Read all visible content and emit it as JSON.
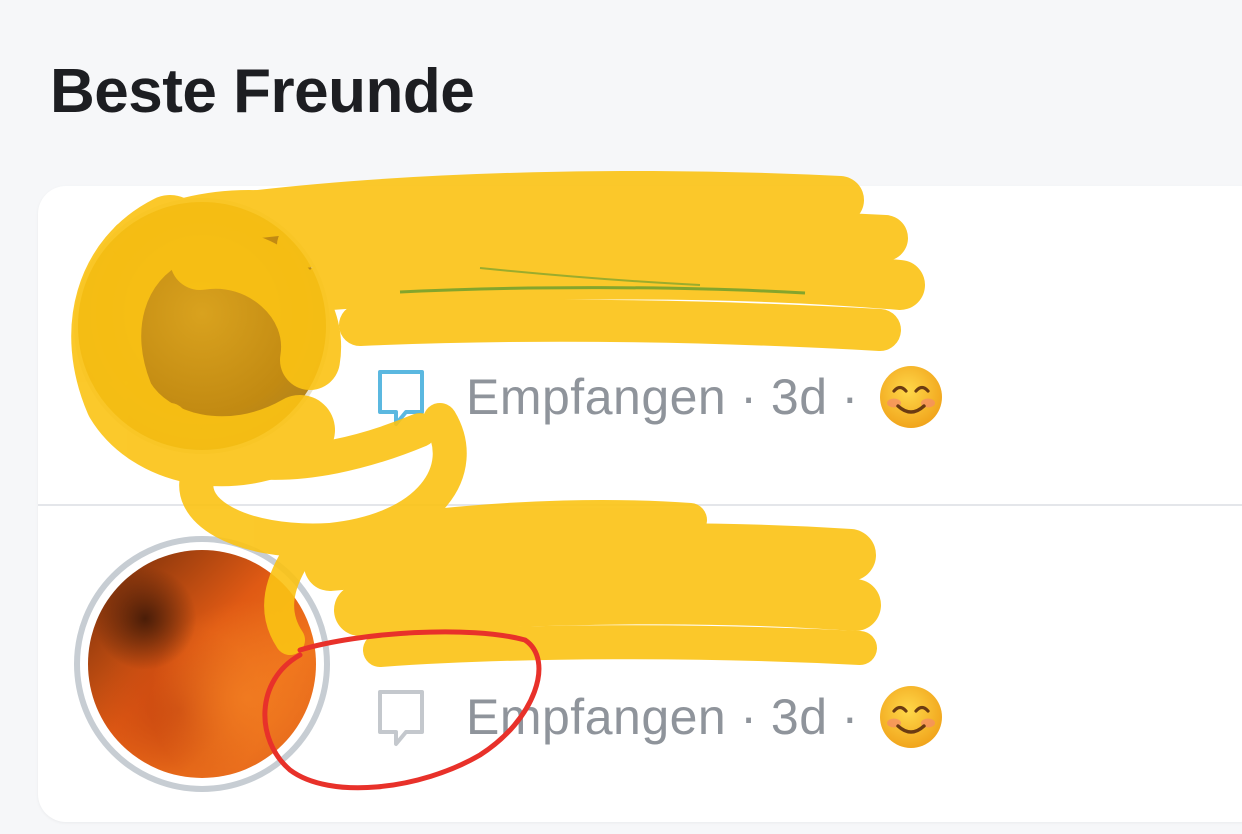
{
  "section": {
    "title": "Beste Freunde"
  },
  "friends": [
    {
      "status": "Empfangen",
      "time": "3d",
      "separator": "·",
      "icon": "chat-bubble-outline-icon",
      "emoji": "smiling-face-emoji"
    },
    {
      "status": "Empfangen",
      "time": "3d",
      "separator": "·",
      "icon": "chat-bubble-outline-icon",
      "emoji": "smiling-face-emoji"
    }
  ],
  "colors": {
    "background": "#f6f7f9",
    "card": "#ffffff",
    "title": "#1d1e22",
    "status_text": "#8f949b",
    "redaction_marker": "#fbc314",
    "annotation_circle": "#e8312a",
    "strike_line": "#5c9a2e"
  }
}
